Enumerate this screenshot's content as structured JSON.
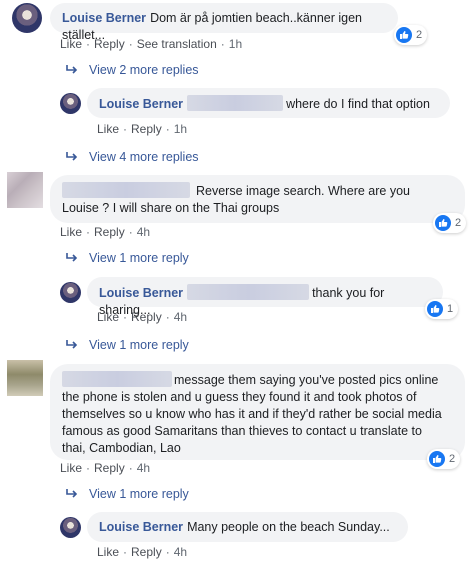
{
  "actions": {
    "like": "Like",
    "reply": "Reply",
    "see_translation": "See translation",
    "dot": "·"
  },
  "comments": [
    {
      "author": "Louise Berner",
      "text": "Dom är på jomtien beach..känner igen stället...",
      "time": "1h",
      "reactions": "2"
    },
    {
      "more_replies": "View 2 more replies",
      "author": "Louise Berner",
      "text": "where do I find that option",
      "time": "1h"
    },
    {
      "more_replies": "View 4 more replies",
      "text": "Reverse image search. Where are you Louise ? I will share on the Thai groups",
      "text_line1": "Reverse image search. Where are you",
      "text_line2": "Louise ? I will share on the Thai groups",
      "time": "4h",
      "reactions": "2"
    },
    {
      "more_replies": "View 1 more reply",
      "author": "Louise Berner",
      "text": "thank you for sharing...",
      "time": "4h",
      "reactions": "1"
    },
    {
      "more_replies": "View 1 more reply",
      "text_line1": "message them saying you've posted pics online",
      "text_line2": "the phone is stolen and u guess they found it and took photos of",
      "text_line3": "themselves so u know who has it and if they'd rather be social media",
      "text_line4": "famous as good Samaritans than thieves to contact u translate to",
      "text_line5": "thai, Cambodian, Lao",
      "time": "4h",
      "reactions": "2"
    },
    {
      "more_replies": "View 1 more reply",
      "author": "Louise Berner",
      "text": "Many people on the beach Sunday...",
      "time": "4h"
    }
  ],
  "colors": {
    "link": "#385898",
    "bubble": "#f2f3f5",
    "like_blue": "#1877f2",
    "meta": "#606770"
  },
  "icons": {
    "reaction": "like-thumb-icon",
    "reply_arrow": "reply-arrow-icon"
  }
}
